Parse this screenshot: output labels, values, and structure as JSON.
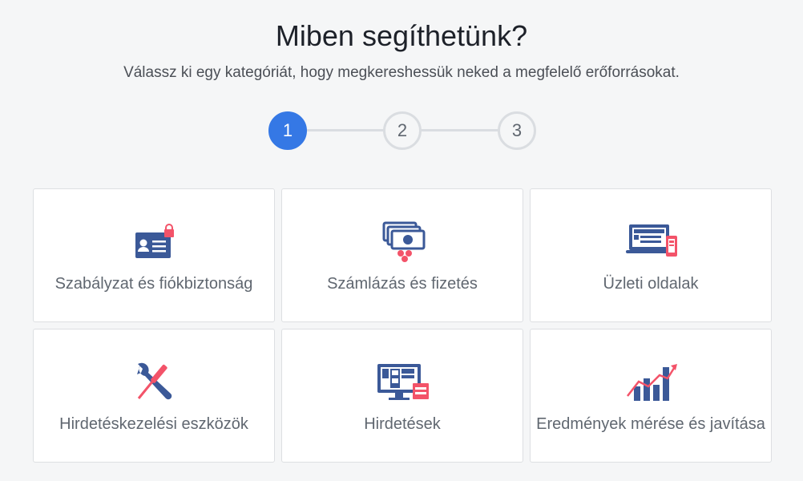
{
  "header": {
    "title": "Miben segíthetünk?",
    "subtitle": "Válassz ki egy kategóriát, hogy megkereshessük neked a megfelelő erőforrásokat."
  },
  "stepper": {
    "steps": [
      "1",
      "2",
      "3"
    ],
    "active_step": "1",
    "active_color": "#3578e5"
  },
  "categories": [
    {
      "label": "Szabályzat és fiókbiztonság",
      "icon": "id-card-lock-icon"
    },
    {
      "label": "Számlázás és fizetés",
      "icon": "billing-cards-icon"
    },
    {
      "label": "Üzleti oldalak",
      "icon": "business-pages-devices-icon"
    },
    {
      "label": "Hirdetéskezelési eszközök",
      "icon": "wrench-screwdriver-icon"
    },
    {
      "label": "Hirdetések",
      "icon": "ads-monitor-icon"
    },
    {
      "label": "Eredmények mérése és javítása",
      "icon": "bar-chart-trend-icon"
    }
  ],
  "colors": {
    "primary_blue": "#3b5998",
    "accent_red": "#f35369"
  }
}
